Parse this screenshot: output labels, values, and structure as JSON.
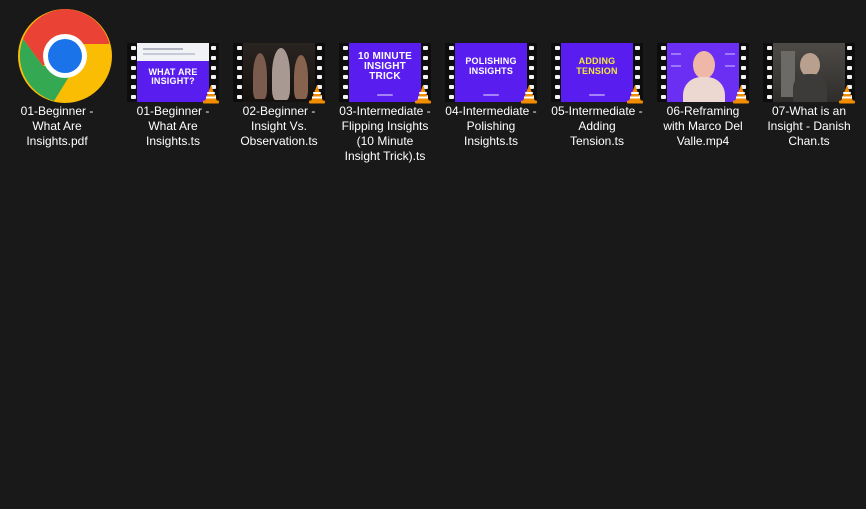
{
  "files": [
    {
      "name": "01-Beginner - What Are Insights.pdf",
      "type": "pdf"
    },
    {
      "name": "01-Beginner - What Are Insights.ts",
      "type": "video",
      "thumb_text": "WHAT ARE INSIGHT?"
    },
    {
      "name": "02-Beginner - Insight Vs. Observation.ts",
      "type": "video"
    },
    {
      "name": "03-Intermediate - Flipping Insights (10 Minute Insight Trick).ts",
      "type": "video",
      "thumb_text": "10 MINUTE INSIGHT TRICK"
    },
    {
      "name": "04-Intermediate - Polishing Insights.ts",
      "type": "video",
      "thumb_text": "POLISHING INSIGHTS"
    },
    {
      "name": "05-Intermediate - Adding Tension.ts",
      "type": "video",
      "thumb_text": "ADDING TENSION"
    },
    {
      "name": "06-Reframing with Marco Del Valle.mp4",
      "type": "video"
    },
    {
      "name": "07-What is an Insight - Danish Chan.ts",
      "type": "video"
    }
  ],
  "display_names": [
    "01-Beginner -\nWhat Are\nInsights.pdf",
    "01-Beginner -\nWhat Are\nInsights.ts",
    "02-Beginner -\nInsight Vs.\nObservation.ts",
    "03-Intermediate -\nFlipping Insights\n(10 Minute\nInsight Trick).ts",
    "04-Intermediate -\nPolishing\nInsights.ts",
    "05-Intermediate -\nAdding\nTension.ts",
    "06-Reframing\nwith Marco Del\nValle.mp4",
    "07-What is an\nInsight - Danish\nChan.ts"
  ],
  "icons": {
    "pdf": "chrome-icon",
    "video": "vlc-icon"
  },
  "colors": {
    "background": "#191919",
    "text": "#ffffff",
    "thumb_purple": "#5b1ee6",
    "thumb_yellow": "#f3e73a",
    "vlc_orange": "#f28d00"
  }
}
